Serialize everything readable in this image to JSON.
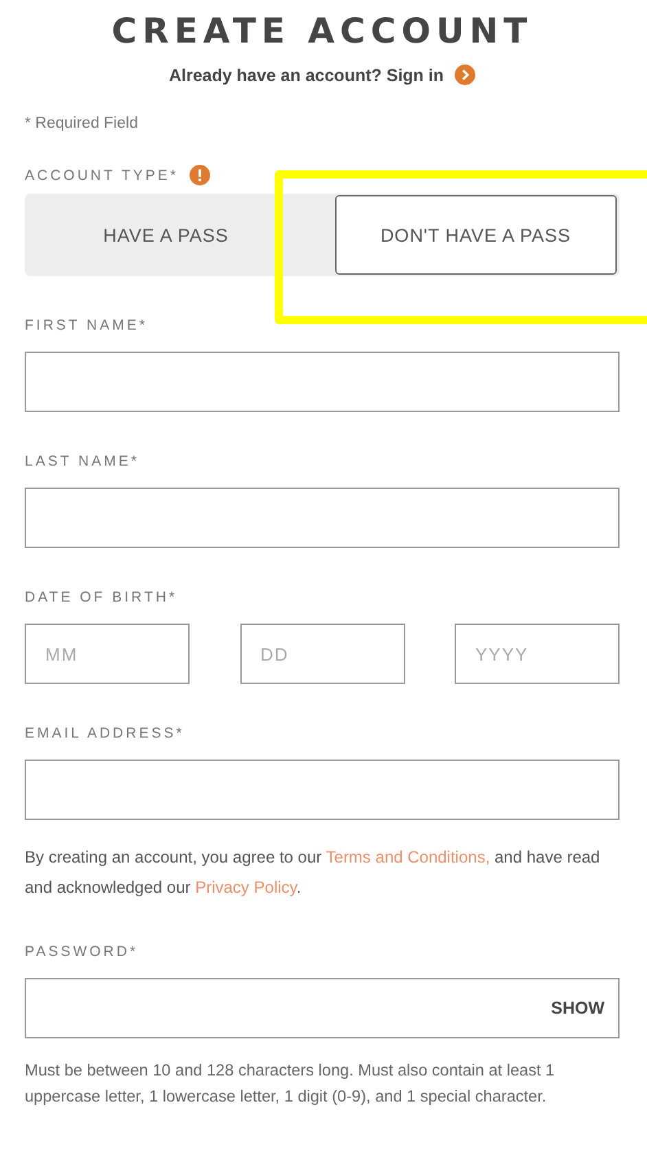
{
  "title": "CREATE ACCOUNT",
  "signin": {
    "text": "Already have an account? Sign in"
  },
  "required_note": "* Required Field",
  "account_type": {
    "label": "ACCOUNT TYPE*",
    "options": [
      {
        "label": "HAVE A PASS",
        "selected": false
      },
      {
        "label": "DON'T HAVE A PASS",
        "selected": true
      }
    ]
  },
  "fields": [
    {
      "kind": "text",
      "label": "FIRST NAME*"
    },
    {
      "kind": "text",
      "label": "LAST NAME*"
    },
    {
      "kind": "date",
      "label": "DATE OF BIRTH*",
      "parts": [
        {
          "placeholder": "MM"
        },
        {
          "placeholder": "DD"
        },
        {
          "placeholder": "YYYY"
        }
      ]
    },
    {
      "kind": "text",
      "label": "EMAIL ADDRESS*"
    }
  ],
  "consent": {
    "before": "By creating an account, you agree to our",
    "terms_link": "Terms and Conditions,",
    "middle": "and have read and acknowledged our",
    "privacy_link": "Privacy Policy",
    "after": "."
  },
  "password": {
    "label": "PASSWORD*",
    "toggle": "SHOW",
    "hint": "Must be between 10 and 128 characters long. Must also contain at least 1 uppercase letter, 1 lowercase letter, 1 digit (0-9), and 1 special character."
  }
}
